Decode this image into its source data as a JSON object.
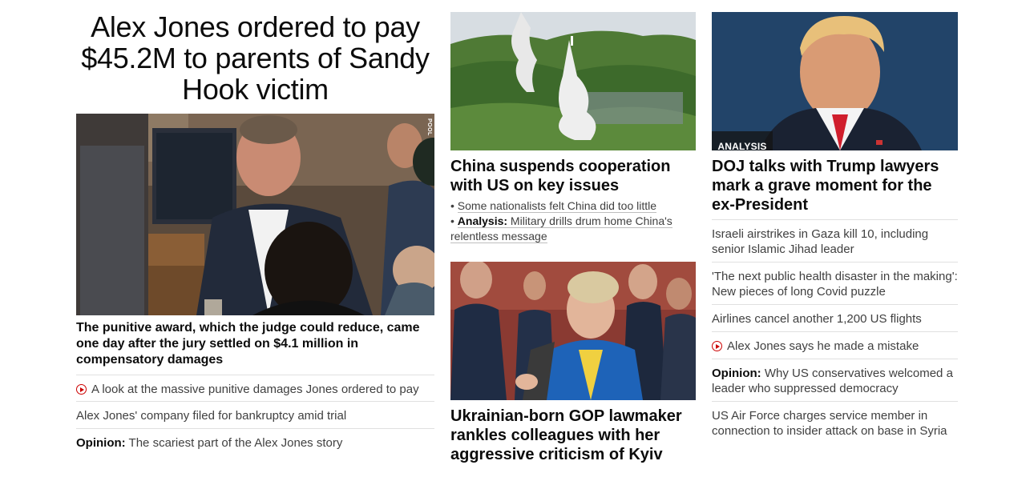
{
  "col1": {
    "headline": "Alex Jones ordered to pay $45.2M to parents of Sandy Hook victim",
    "image_credit": "POOL",
    "summary": "The punitive award, which the judge could reduce, came one day after the jury settled on $4.1 million in compensatory damages",
    "links": [
      {
        "text": "A look at the massive punitive damages Jones ordered to pay",
        "video": true
      },
      {
        "text": "Alex Jones' company filed for bankruptcy amid trial"
      },
      {
        "prefix": "Opinion:",
        "text": " The scariest part of the Alex Jones story"
      }
    ]
  },
  "col2": {
    "story1": {
      "headline": "China suspends cooperation with US on key issues",
      "bullets": [
        {
          "text": "Some nationalists felt China did too little"
        },
        {
          "prefix": "Analysis:",
          "text": " Military drills drum home China's relentless message"
        }
      ]
    },
    "story2": {
      "headline": "Ukrainian-born GOP lawmaker rankles colleagues with her aggressive criticism of Kyiv"
    }
  },
  "col3": {
    "badge": "ANALYSIS",
    "headline": "DOJ talks with Trump lawyers mark a grave moment for the ex-President",
    "links": [
      {
        "text": "Israeli airstrikes in Gaza kill 10, including senior Islamic Jihad leader"
      },
      {
        "text": "'The next public health disaster in the making': New pieces of long Covid puzzle"
      },
      {
        "text": "Airlines cancel another 1,200 US flights"
      },
      {
        "text": "Alex Jones says he made a mistake",
        "video": true
      },
      {
        "prefix": "Opinion:",
        "text": " Why US conservatives welcomed a leader who suppressed democracy"
      },
      {
        "text": "US Air Force charges service member in connection to insider attack on base in Syria"
      }
    ]
  },
  "colors": {
    "accent_red": "#cc0000",
    "text": "#0c0c0c",
    "muted": "#404040",
    "divider": "#e0e0e0"
  }
}
